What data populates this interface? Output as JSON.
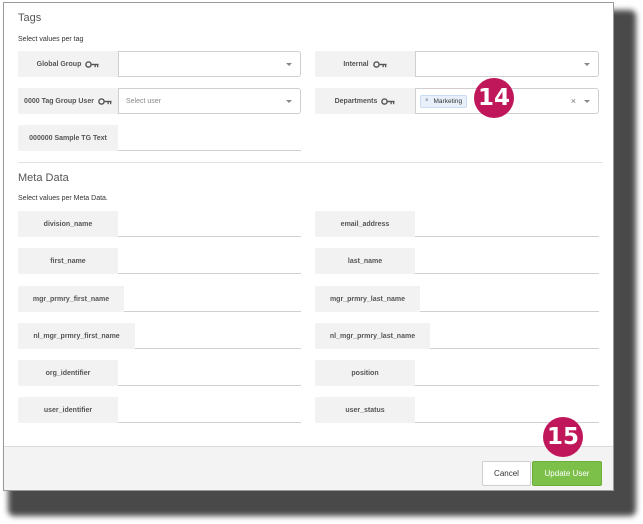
{
  "tags": {
    "title": "Tags",
    "subtitle": "Select values per tag",
    "fields": [
      {
        "label": "Global Group",
        "value": "",
        "key": true
      },
      {
        "label": "Internal",
        "value": "",
        "key": true
      },
      {
        "label": "0000 Tag Group User",
        "placeholder": "Select user",
        "key": true
      },
      {
        "label": "Departments",
        "chip": "Marketing",
        "chip_x": "×",
        "clear": "×",
        "key": true
      },
      {
        "label": "000000 Sample TG Text",
        "value": ""
      }
    ]
  },
  "meta": {
    "title": "Meta Data",
    "subtitle": "Select values per Meta Data.",
    "fields": [
      {
        "label": "division_name",
        "value": ""
      },
      {
        "label": "email_address",
        "value": ""
      },
      {
        "label": "first_name",
        "value": ""
      },
      {
        "label": "last_name",
        "value": ""
      },
      {
        "label": "mgr_prmry_first_name",
        "value": ""
      },
      {
        "label": "mgr_prmry_last_name",
        "value": ""
      },
      {
        "label": "nl_mgr_prmry_first_name",
        "value": ""
      },
      {
        "label": "nl_mgr_prmry_last_name",
        "value": ""
      },
      {
        "label": "org_identifier",
        "value": ""
      },
      {
        "label": "position",
        "value": ""
      },
      {
        "label": "user_identifier",
        "value": ""
      },
      {
        "label": "user_status",
        "value": ""
      }
    ]
  },
  "footer": {
    "cancel_label": "Cancel",
    "update_label": "Update User"
  },
  "callouts": {
    "badge_14": "14",
    "badge_15": "15"
  },
  "colors": {
    "accent_green": "#7cc04a",
    "callout": "#c0165a",
    "chip_bg": "#e8f1fb"
  },
  "icons": {
    "key": "key-icon",
    "caret": "chevron-down-icon"
  }
}
